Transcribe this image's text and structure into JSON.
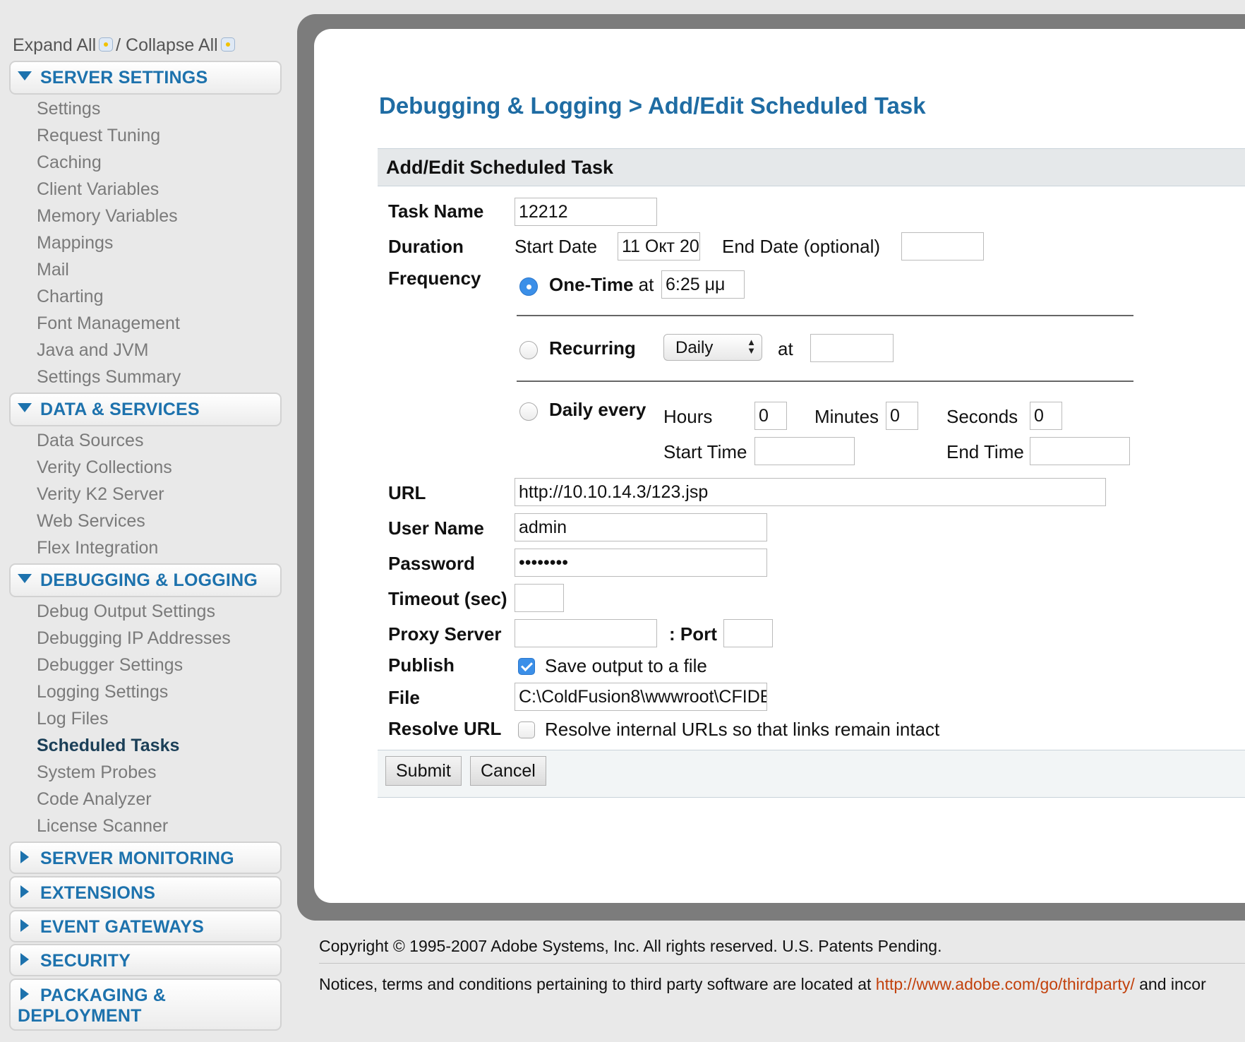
{
  "sidebar": {
    "expand_all": "Expand All",
    "separator": "/",
    "collapse_all": "Collapse All",
    "sections": {
      "server_settings": {
        "title": "SERVER SETTINGS",
        "items": [
          "Settings",
          "Request Tuning",
          "Caching",
          "Client Variables",
          "Memory Variables",
          "Mappings",
          "Mail",
          "Charting",
          "Font Management",
          "Java and JVM",
          "Settings Summary"
        ]
      },
      "data_services": {
        "title": "DATA & SERVICES",
        "items": [
          "Data Sources",
          "Verity Collections",
          "Verity K2 Server",
          "Web Services",
          "Flex Integration"
        ]
      },
      "debugging_logging": {
        "title": "DEBUGGING & LOGGING",
        "items": [
          "Debug Output Settings",
          "Debugging IP Addresses",
          "Debugger Settings",
          "Logging Settings",
          "Log Files",
          "Scheduled Tasks",
          "System Probes",
          "Code Analyzer",
          "License Scanner"
        ],
        "active_item": "Scheduled Tasks"
      },
      "server_monitoring": {
        "title": "SERVER MONITORING"
      },
      "extensions": {
        "title": "EXTENSIONS"
      },
      "event_gateways": {
        "title": "EVENT GATEWAYS"
      },
      "security": {
        "title": "SECURITY"
      },
      "packaging_deployment": {
        "title_line1": "PACKAGING &",
        "title_line2": "DEPLOYMENT"
      }
    }
  },
  "main": {
    "page_title": "Debugging & Logging > Add/Edit Scheduled Task",
    "form_title": "Add/Edit Scheduled Task",
    "labels": {
      "task_name": "Task Name",
      "duration": "Duration",
      "frequency": "Frequency",
      "url": "URL",
      "user_name": "User Name",
      "password": "Password",
      "timeout": "Timeout (sec)",
      "proxy_server": "Proxy Server",
      "port": ": Port",
      "publish": "Publish",
      "file": "File",
      "resolve_url": "Resolve URL"
    },
    "values": {
      "task_name": "12212",
      "start_date": "11 Окт 20",
      "end_date": "",
      "one_time_at": "6:25 μμ",
      "recurring_at": "",
      "hours": "0",
      "minutes": "0",
      "seconds": "0",
      "start_time": "",
      "end_time": "",
      "url": "http://10.10.14.3/123.jsp",
      "user_name": "admin",
      "password": "••••••••",
      "timeout": "",
      "proxy_server": "",
      "port": "",
      "file": "C:\\ColdFusion8\\wwwroot\\CFIDE"
    },
    "duration": {
      "start_date_label": "Start Date",
      "end_date_label": "End Date (optional)"
    },
    "frequency": {
      "one_time_label": "One-Time",
      "at_label": "at",
      "recurring_label": "Recurring",
      "recurring_selected": "Daily",
      "recurring_at_label": "at",
      "daily_every_label": "Daily every",
      "hours_label": "Hours",
      "minutes_label": "Minutes",
      "seconds_label": "Seconds",
      "start_time_label": "Start Time",
      "end_time_label": "End Time",
      "selected": "one_time"
    },
    "publish": {
      "label": "Save output to a file",
      "checked": true
    },
    "resolve": {
      "label": "Resolve internal URLs so that links remain intact",
      "checked": false
    },
    "buttons": {
      "submit": "Submit",
      "cancel": "Cancel"
    }
  },
  "footer": {
    "copyright": "Copyright © 1995-2007 Adobe Systems, Inc. All rights reserved. U.S. Patents Pending.",
    "notice_prefix": "Notices, terms and conditions pertaining to third party software are located at ",
    "notice_link": "http://www.adobe.com/go/thirdparty/",
    "notice_suffix": " and incor"
  },
  "colors": {
    "accent": "#1d72ad",
    "title": "#1f6ca3",
    "link": "#c2410c",
    "radio_checked": "#3b8fe8"
  }
}
